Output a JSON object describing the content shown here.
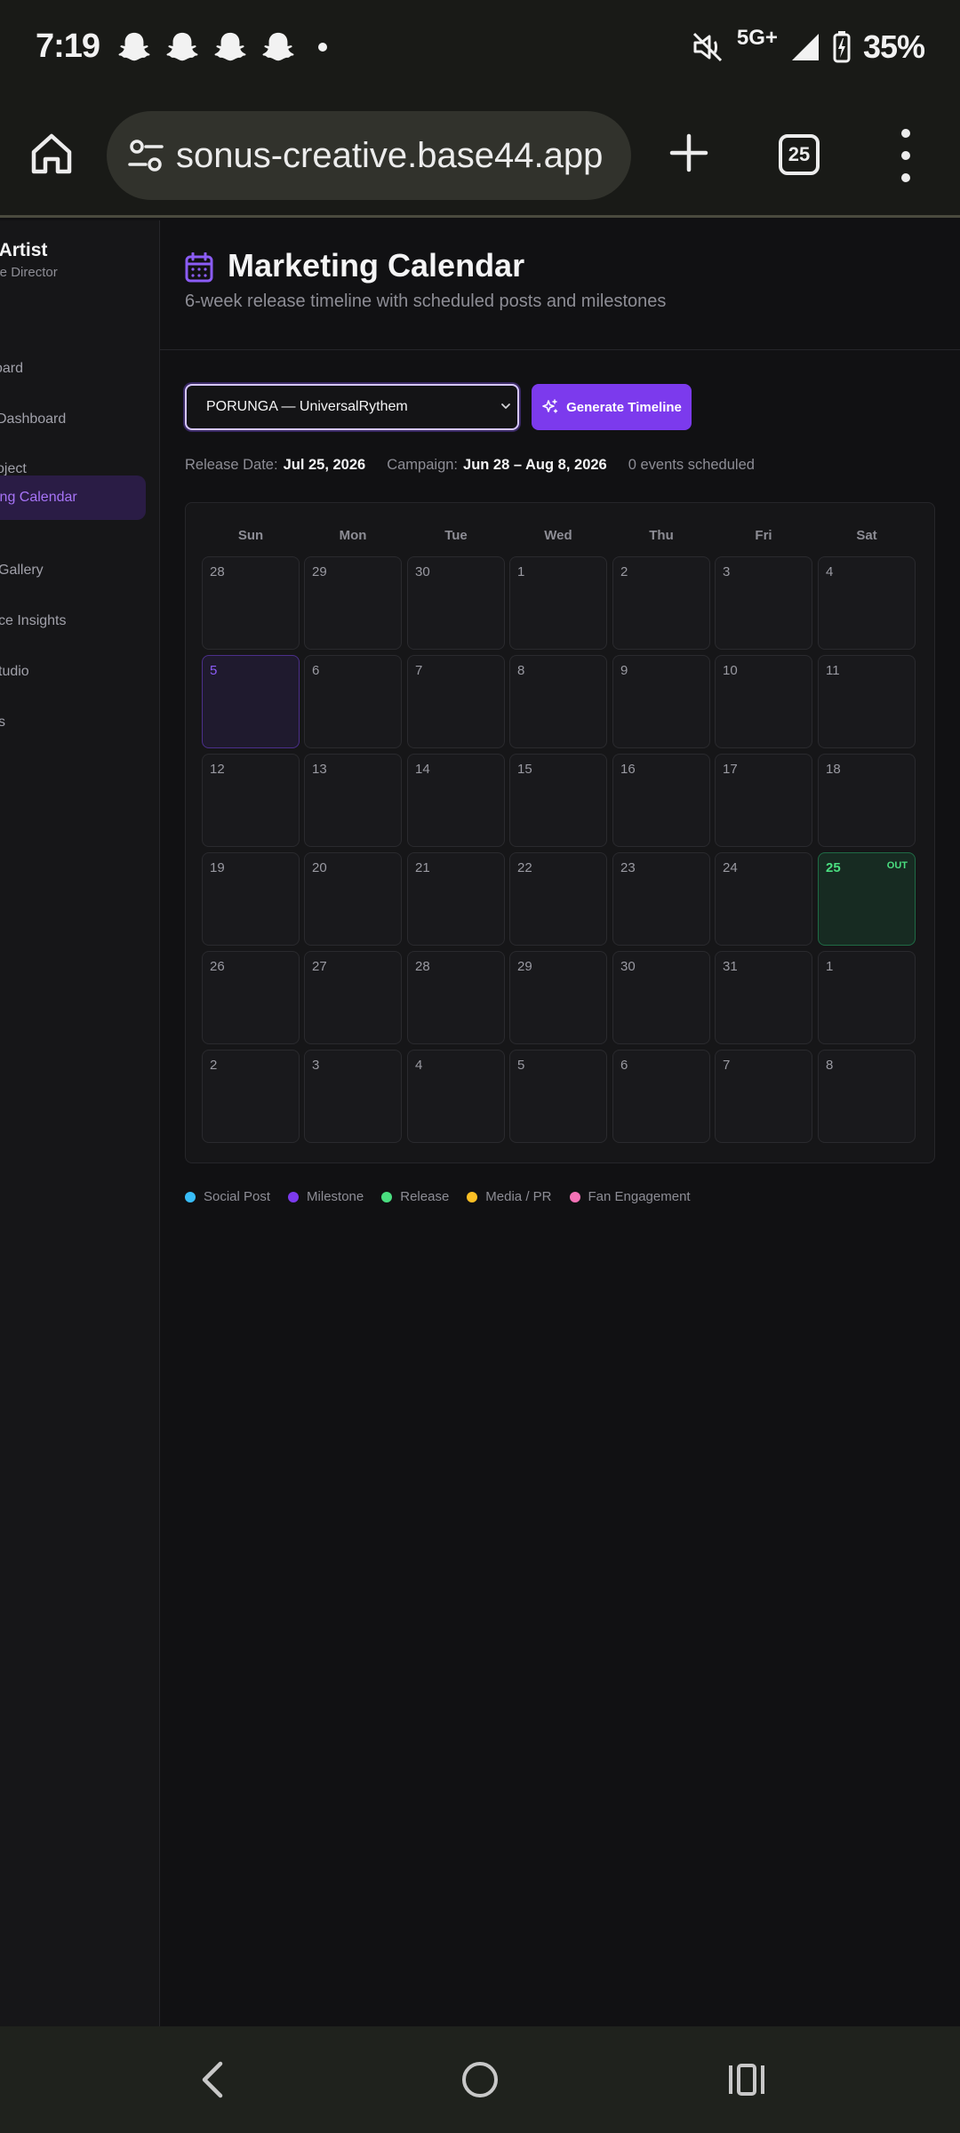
{
  "status_bar": {
    "time": "7:19",
    "notification_icons": [
      "snapchat-icon",
      "snapchat-icon",
      "snapchat-icon",
      "snapchat-icon"
    ],
    "network": "5G+",
    "battery": "35%"
  },
  "browser": {
    "url": "sonus-creative.base44.app",
    "tab_count": "25"
  },
  "sidebar": {
    "profile_name": "ie Artist",
    "profile_role": "eative Director",
    "items": [
      {
        "label": "oard"
      },
      {
        "label": "Dashboard"
      },
      {
        "label": "oject"
      },
      {
        "label": "ing Calendar",
        "active": true
      },
      {
        "label": "Gallery"
      },
      {
        "label": "ce Insights"
      },
      {
        "label": "tudio"
      },
      {
        "label": "s"
      }
    ]
  },
  "header": {
    "title": "Marketing Calendar",
    "subtitle": "6-week release timeline with scheduled posts and milestones"
  },
  "controls": {
    "project_select": "PORUNGA — UniversalRythem",
    "generate_button": "Generate Timeline"
  },
  "meta": {
    "release_label": "Release Date:",
    "release_value": "Jul 25, 2026",
    "campaign_label": "Campaign:",
    "campaign_value": "Jun 28 – Aug 8, 2026",
    "events": "0 events scheduled"
  },
  "calendar": {
    "weekdays": [
      "Sun",
      "Mon",
      "Tue",
      "Wed",
      "Thu",
      "Fri",
      "Sat"
    ],
    "weeks": [
      [
        "28",
        "29",
        "30",
        "1",
        "2",
        "3",
        "4"
      ],
      [
        "5",
        "6",
        "7",
        "8",
        "9",
        "10",
        "11"
      ],
      [
        "12",
        "13",
        "14",
        "15",
        "16",
        "17",
        "18"
      ],
      [
        "19",
        "20",
        "21",
        "22",
        "23",
        "24",
        "25"
      ],
      [
        "26",
        "27",
        "28",
        "29",
        "30",
        "31",
        "1"
      ],
      [
        "2",
        "3",
        "4",
        "5",
        "6",
        "7",
        "8"
      ]
    ],
    "today_cell": [
      1,
      0
    ],
    "release_cell": [
      3,
      6
    ],
    "release_badge": "OUT"
  },
  "legend": [
    {
      "label": "Social Post",
      "color": "#38bdf8"
    },
    {
      "label": "Milestone",
      "color": "#7c3aed"
    },
    {
      "label": "Release",
      "color": "#4ade80"
    },
    {
      "label": "Media / PR",
      "color": "#fbbf24"
    },
    {
      "label": "Fan Engagement",
      "color": "#f472b6"
    }
  ],
  "colors": {
    "accent": "#7c3aed",
    "release": "#4ade80",
    "background": "#111113"
  }
}
